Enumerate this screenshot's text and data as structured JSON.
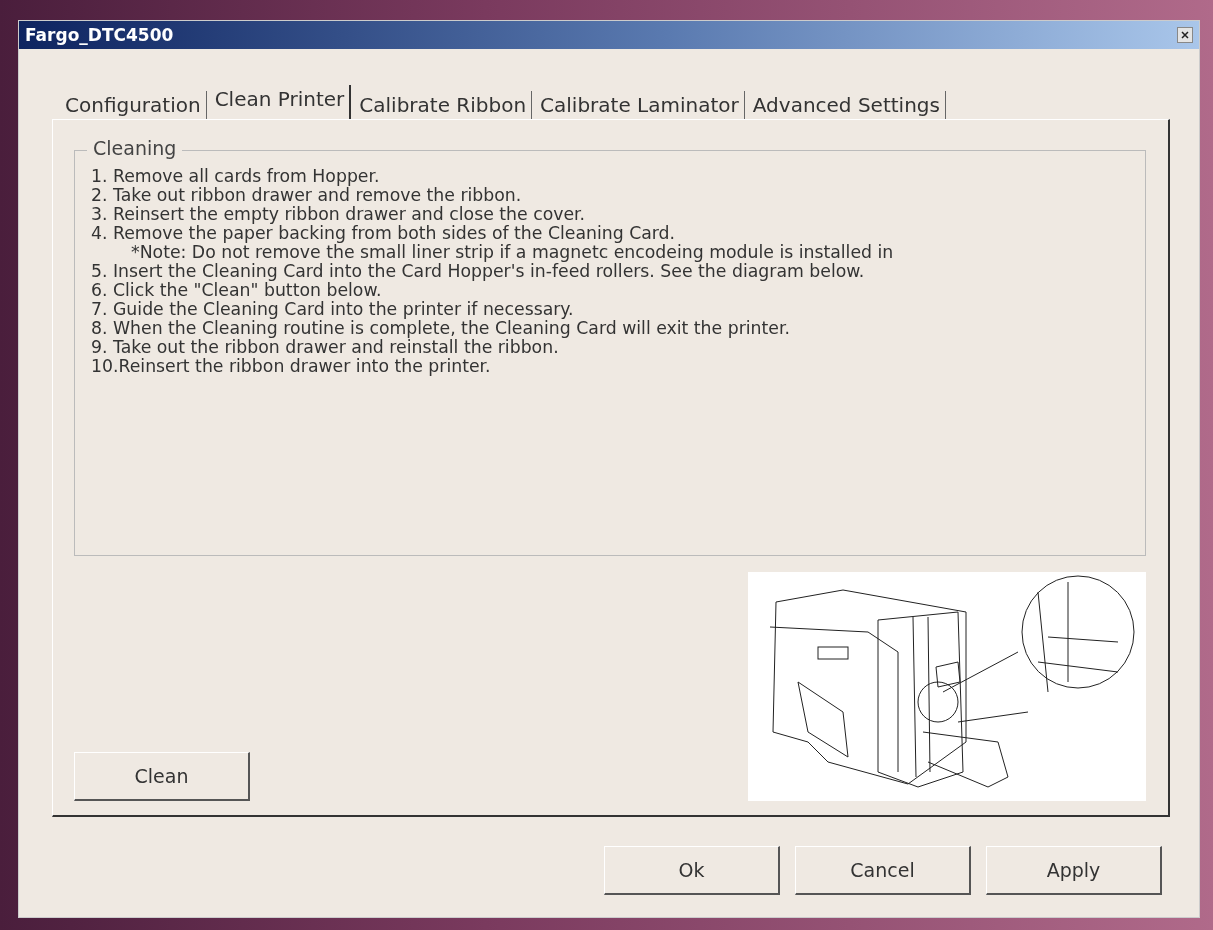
{
  "window": {
    "title": "Fargo_DTC4500"
  },
  "tabs": [
    {
      "label": "Configuration",
      "selected": false
    },
    {
      "label": "Clean Printer",
      "selected": true
    },
    {
      "label": "Calibrate Ribbon",
      "selected": false
    },
    {
      "label": "Calibrate Laminator",
      "selected": false
    },
    {
      "label": "Advanced Settings",
      "selected": false
    }
  ],
  "cleaning": {
    "title": "Cleaning",
    "steps": [
      {
        "text": "1. Remove all cards from Hopper.",
        "kind": "step"
      },
      {
        "text": "2. Take out ribbon drawer and remove the ribbon.",
        "kind": "step"
      },
      {
        "text": "3. Reinsert the empty ribbon drawer and close the cover.",
        "kind": "step"
      },
      {
        "text": "4. Remove the paper backing from both sides of the Cleaning Card.",
        "kind": "step"
      },
      {
        "text": "*Note: Do not remove the small liner strip if a magnetc encodeing module is installed in",
        "kind": "note"
      },
      {
        "text": "5. Insert the Cleaning Card into the Card Hopper's in-feed rollers. See the diagram below.",
        "kind": "step"
      },
      {
        "text": "6. Click the \"Clean\" button below.",
        "kind": "step"
      },
      {
        "text": "7. Guide the Cleaning Card into the printer if necessary.",
        "kind": "step"
      },
      {
        "text": "8. When the Cleaning routine is complete, the Cleaning Card will exit the printer.",
        "kind": "step"
      },
      {
        "text": "9. Take out the ribbon drawer and reinstall the ribbon.",
        "kind": "step"
      },
      {
        "text": "10.Reinsert the ribbon drawer into the printer.",
        "kind": "step"
      }
    ]
  },
  "clean_button": "Clean",
  "buttons": [
    "Ok",
    "Cancel",
    "Apply"
  ]
}
